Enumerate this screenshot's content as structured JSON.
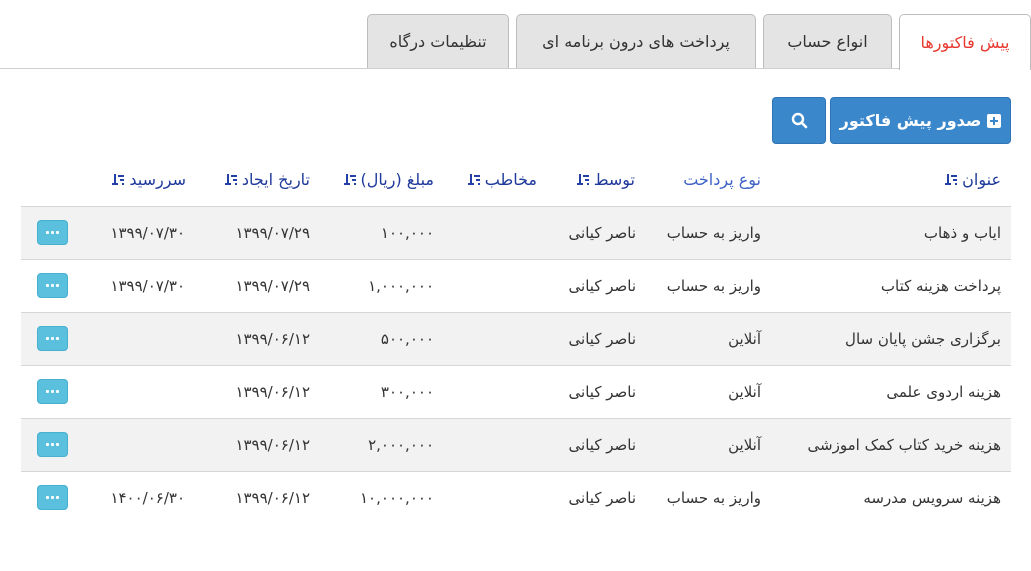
{
  "tabs": [
    {
      "label": "پیش فاکتورها",
      "active": true
    },
    {
      "label": "انواع حساب",
      "active": false
    },
    {
      "label": "پرداخت های درون برنامه ای",
      "active": false
    },
    {
      "label": "تنظیمات درگاه",
      "active": false
    }
  ],
  "toolbar": {
    "new_invoice_label": "صدور پیش فاکتور",
    "new_icon": "plus-square-icon",
    "search_icon": "search-icon"
  },
  "table": {
    "headers": {
      "title": "عنوان",
      "payment_type": "نوع پرداخت",
      "by": "توسط",
      "recipient": "مخاطب",
      "amount": "مبلغ (ریال)",
      "created": "تاریخ ایجاد",
      "due": "سررسید"
    },
    "rows": [
      {
        "title": "ایاب و ذهاب",
        "payment_type": "واریز به حساب",
        "by": "ناصر کیانی",
        "recipient": "",
        "amount": "۱۰۰,۰۰۰",
        "created": "۱۳۹۹/۰۷/۲۹",
        "due": "۱۳۹۹/۰۷/۳۰"
      },
      {
        "title": "پرداخت هزینه کتاب",
        "payment_type": "واریز به حساب",
        "by": "ناصر کیانی",
        "recipient": "",
        "amount": "۱,۰۰۰,۰۰۰",
        "created": "۱۳۹۹/۰۷/۲۹",
        "due": "۱۳۹۹/۰۷/۳۰"
      },
      {
        "title": "برگزاری جشن پایان سال",
        "payment_type": "آنلاین",
        "by": "ناصر کیانی",
        "recipient": "",
        "amount": "۵۰۰,۰۰۰",
        "created": "۱۳۹۹/۰۶/۱۲",
        "due": ""
      },
      {
        "title": "هزینه اردوی علمی",
        "payment_type": "آنلاین",
        "by": "ناصر کیانی",
        "recipient": "",
        "amount": "۳۰۰,۰۰۰",
        "created": "۱۳۹۹/۰۶/۱۲",
        "due": ""
      },
      {
        "title": "هزینه خرید کتاب کمک اموزشی",
        "payment_type": "آنلاین",
        "by": "ناصر کیانی",
        "recipient": "",
        "amount": "۲,۰۰۰,۰۰۰",
        "created": "۱۳۹۹/۰۶/۱۲",
        "due": ""
      },
      {
        "title": "هزینه سرویس مدرسه",
        "payment_type": "واریز به حساب",
        "by": "ناصر کیانی",
        "recipient": "",
        "amount": "۱۰,۰۰۰,۰۰۰",
        "created": "۱۳۹۹/۰۶/۱۲",
        "due": "۱۴۰۰/۰۶/۳۰"
      }
    ]
  },
  "colors": {
    "primary": "#3a87cc",
    "info": "#5bc0de",
    "active_tab_text": "#e8382f",
    "header_text": "#1f3a9b",
    "row_stripe": "#f2f2f2"
  }
}
